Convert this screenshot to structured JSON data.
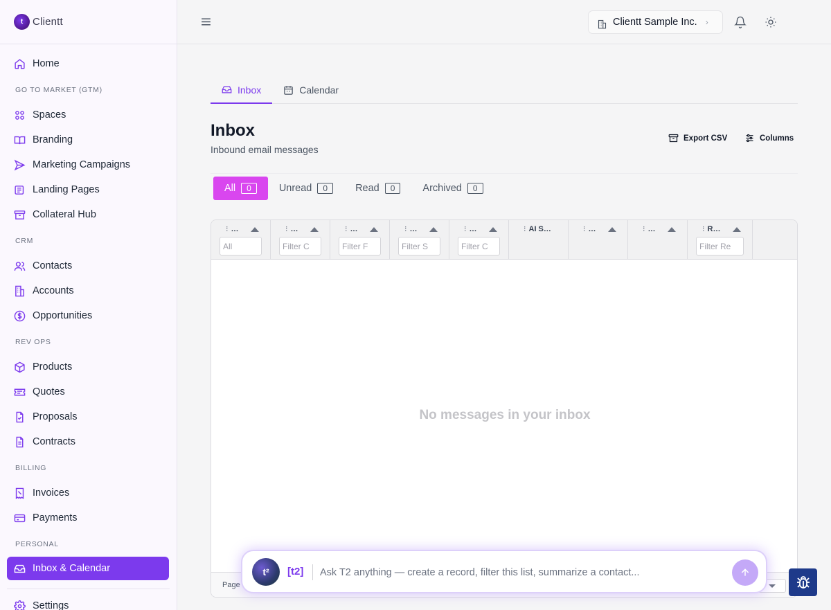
{
  "brand": {
    "name": "Clientt"
  },
  "sidebar": {
    "home": "Home",
    "sections": [
      {
        "title": "GO TO MARKET (GTM)",
        "items": [
          "Spaces",
          "Branding",
          "Marketing Campaigns",
          "Landing Pages",
          "Collateral Hub"
        ]
      },
      {
        "title": "CRM",
        "items": [
          "Contacts",
          "Accounts",
          "Opportunities"
        ]
      },
      {
        "title": "REV OPS",
        "items": [
          "Products",
          "Quotes",
          "Proposals",
          "Contracts"
        ]
      },
      {
        "title": "BILLING",
        "items": [
          "Invoices",
          "Payments"
        ]
      },
      {
        "title": "PERSONAL",
        "items": [
          "Inbox & Calendar"
        ]
      }
    ],
    "settings": "Settings",
    "accent": "#7c3aed"
  },
  "header": {
    "org_name": "Clientt Sample Inc."
  },
  "tabs": [
    {
      "label": "Inbox",
      "active": true
    },
    {
      "label": "Calendar",
      "active": false
    }
  ],
  "page": {
    "title": "Inbox",
    "subtitle": "Inbound email messages",
    "export_label": "Export CSV",
    "columns_label": "Columns"
  },
  "filters": [
    {
      "label": "All",
      "count": "0",
      "active": true
    },
    {
      "label": "Unread",
      "count": "0",
      "active": false
    },
    {
      "label": "Read",
      "count": "0",
      "active": false
    },
    {
      "label": "Archived",
      "count": "0",
      "active": false
    }
  ],
  "grid": {
    "columns": [
      {
        "title": "…",
        "filter": "All"
      },
      {
        "title": "…",
        "filter": "Filter C"
      },
      {
        "title": "…",
        "filter": "Filter F"
      },
      {
        "title": "…",
        "filter": "Filter S"
      },
      {
        "title": "…",
        "filter": "Filter C"
      },
      {
        "title": "AI S…",
        "filter": null
      },
      {
        "title": "…",
        "filter": null
      },
      {
        "title": "…",
        "filter": null
      },
      {
        "title": "R…",
        "filter": "Filter Re"
      }
    ],
    "empty_message": "No messages in your inbox",
    "page_label": "Page"
  },
  "ai": {
    "tag": "[t2]",
    "avatar_text": "t²",
    "placeholder": "Ask T2 anything — create a record, filter this list, summarize a contact..."
  }
}
